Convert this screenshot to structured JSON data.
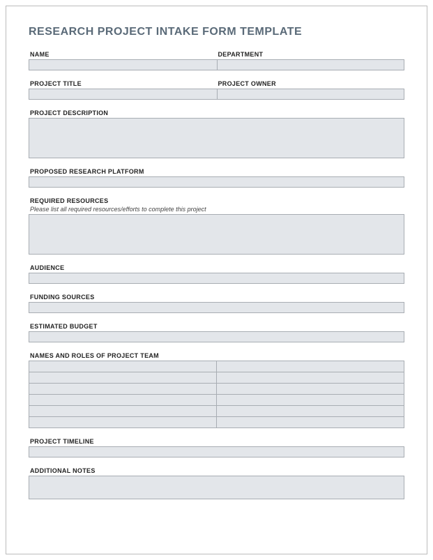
{
  "title": "RESEARCH PROJECT INTAKE FORM TEMPLATE",
  "labels": {
    "name": "NAME",
    "department": "DEPARTMENT",
    "projectTitle": "PROJECT TITLE",
    "projectOwner": "PROJECT OWNER",
    "projectDescription": "PROJECT DESCRIPTION",
    "proposedPlatform": "PROPOSED RESEARCH PLATFORM",
    "requiredResources": "REQUIRED RESOURCES",
    "requiredResourcesHint": "Please list all required resources/efforts to complete this project",
    "audience": "AUDIENCE",
    "fundingSources": "FUNDING SOURCES",
    "estimatedBudget": "ESTIMATED BUDGET",
    "teamNamesRoles": "NAMES AND ROLES OF PROJECT TEAM",
    "projectTimeline": "PROJECT TIMELINE",
    "additionalNotes": "ADDITIONAL NOTES"
  },
  "values": {
    "name": "",
    "department": "",
    "projectTitle": "",
    "projectOwner": "",
    "projectDescription": "",
    "proposedPlatform": "",
    "requiredResources": "",
    "audience": "",
    "fundingSources": "",
    "estimatedBudget": "",
    "projectTimeline": "",
    "additionalNotes": ""
  },
  "teamRows": 6
}
